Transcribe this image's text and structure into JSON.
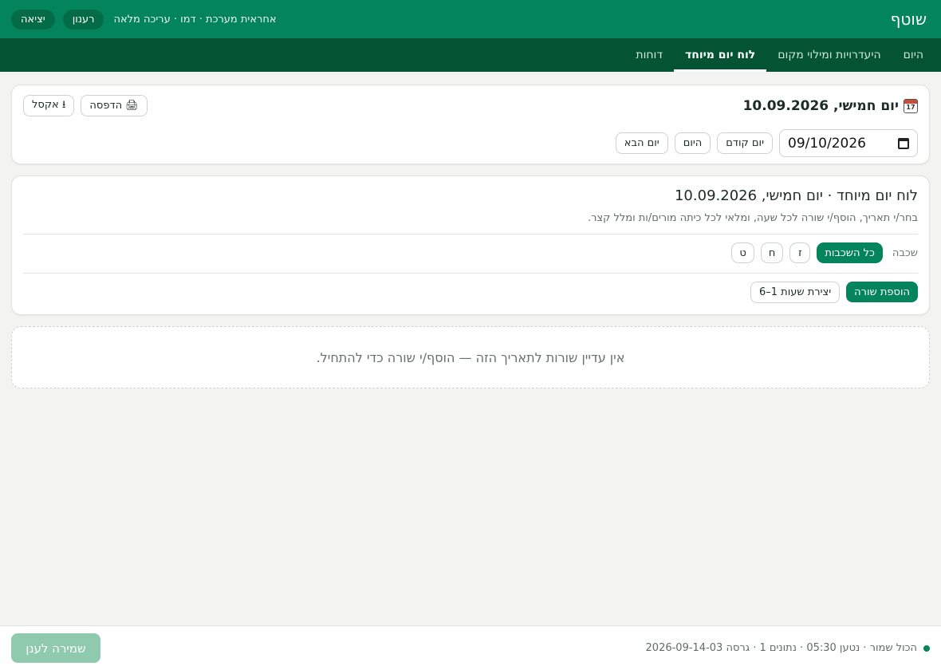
{
  "header": {
    "brand": "שוטף",
    "user_info": "אחראית מערכת · דמו · עריכה מלאה",
    "refresh_label": "רענון",
    "logout_label": "יציאה"
  },
  "nav": {
    "tabs": [
      {
        "label": "היום",
        "active": false
      },
      {
        "label": "היעדרויות ומילוי מקום",
        "active": false
      },
      {
        "label": "לוח יום מיוחד",
        "active": true
      },
      {
        "label": "דוחות",
        "active": false
      }
    ]
  },
  "date_card": {
    "title": "יום חמישי, 10.09.2026",
    "print_label": "🖨 הדפסה",
    "excel_label": "⭳ אקסל",
    "date_value": "09/10/2026",
    "prev_day_label": "יום קודם",
    "today_label": "היום",
    "next_day_label": "יום הבא"
  },
  "special": {
    "title": "לוח יום מיוחד · יום חמישי, 10.09.2026",
    "subtitle": "בחר/י תאריך, הוסף/י שורה לכל שעה, ומלאי לכל כיתה מורים/ות ומלל קצר.",
    "grade_label": "שכבה",
    "grades": [
      "כל השכבות",
      "ז",
      "ח",
      "ט"
    ],
    "add_row_label": "הוספת שורה",
    "create_hours_label": "יצירת שעות 1–6"
  },
  "empty": {
    "message": "אין עדיין שורות לתאריך הזה — הוסף/י שורה כדי להתחיל."
  },
  "footer": {
    "status_text": "הכול שמור · נטען 05:30 · נתונים 1 · גרסה 2026-09-14-03",
    "save_label": "שמירה לענן"
  },
  "colors": {
    "primary": "#04845a",
    "nav_bg": "#045433",
    "save_disabled": "#8fc9ae"
  }
}
